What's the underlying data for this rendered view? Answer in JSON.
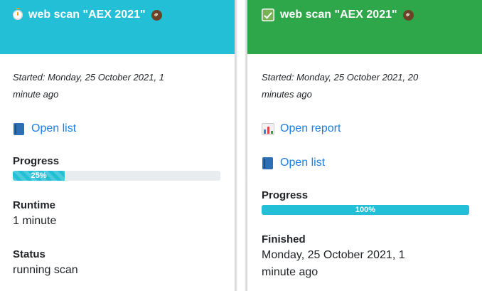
{
  "cards": [
    {
      "title": "web scan \"AEX 2021\"",
      "status_icon": "timer-icon",
      "header_color": "#23bfd6",
      "started": "Started: Monday, 25 October 2021, 1 minute ago",
      "links": [
        {
          "icon": "book-icon",
          "label": "Open list"
        }
      ],
      "progress_label": "Progress",
      "progress_value": 0.25,
      "progress_text": "25%",
      "progress_color": "#23bfd6",
      "runtime_label": "Runtime",
      "runtime_value": "1 minute",
      "status_label": "Status",
      "status_value": "running scan"
    },
    {
      "title": "web scan \"AEX 2021\"",
      "status_icon": "check-icon",
      "header_color": "#2ea74a",
      "started": "Started: Monday, 25 October 2021, 20 minutes ago",
      "links": [
        {
          "icon": "bar-chart-icon",
          "label": "Open report"
        },
        {
          "icon": "book-icon",
          "label": "Open list"
        }
      ],
      "progress_label": "Progress",
      "progress_value": 1.0,
      "progress_text": "100%",
      "progress_color": "#23bfd6",
      "finished_label": "Finished",
      "finished_value": "Monday, 25 October 2021, 1 minute ago"
    }
  ],
  "icons": {
    "link_badge": "link-icon",
    "link_glyph": "⚭"
  }
}
